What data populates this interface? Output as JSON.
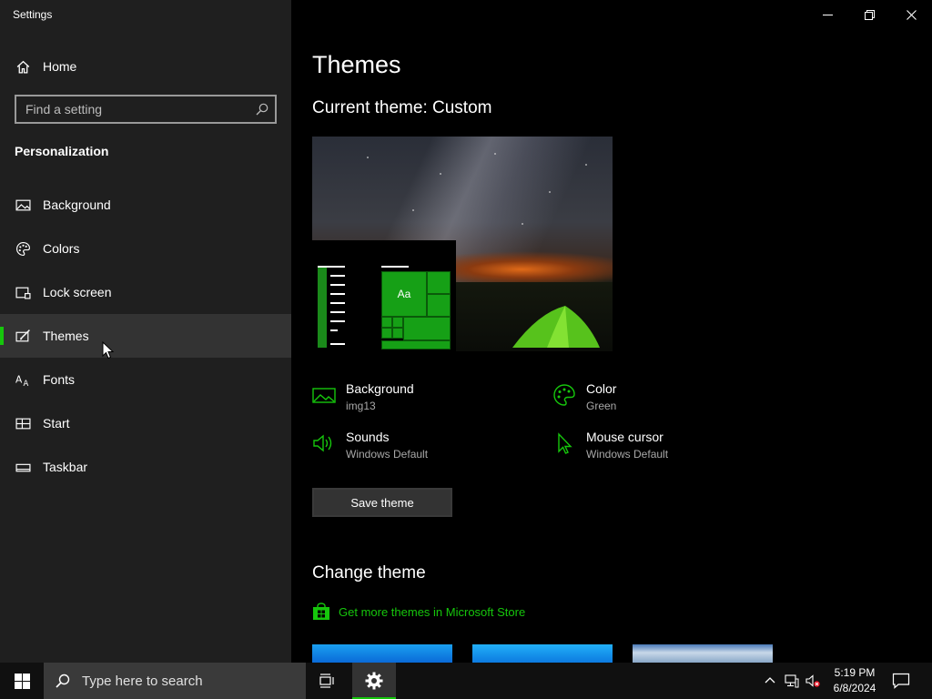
{
  "window": {
    "app_title": "Settings",
    "caption": [
      "minimize-icon",
      "restore-icon",
      "close-icon"
    ]
  },
  "sidebar": {
    "home_label": "Home",
    "search_placeholder": "Find a setting",
    "section_title": "Personalization",
    "items": [
      {
        "label": "Background",
        "icon": "picture-icon",
        "selected": false
      },
      {
        "label": "Colors",
        "icon": "palette-icon",
        "selected": false
      },
      {
        "label": "Lock screen",
        "icon": "lock-screen-icon",
        "selected": false
      },
      {
        "label": "Themes",
        "icon": "themes-brush-icon",
        "selected": true
      },
      {
        "label": "Fonts",
        "icon": "fonts-icon",
        "selected": false
      },
      {
        "label": "Start",
        "icon": "start-icon",
        "selected": false
      },
      {
        "label": "Taskbar",
        "icon": "taskbar-icon",
        "selected": false
      }
    ]
  },
  "main": {
    "page_title": "Themes",
    "current_theme": "Current theme: Custom",
    "preview_tile_text": "Aa",
    "properties": {
      "background": {
        "title": "Background",
        "value": "img13"
      },
      "color": {
        "title": "Color",
        "value": "Green"
      },
      "sounds": {
        "title": "Sounds",
        "value": "Windows Default"
      },
      "mouse_cursor": {
        "title": "Mouse cursor",
        "value": "Windows Default"
      }
    },
    "save_button": "Save theme",
    "change_theme_title": "Change theme",
    "store_link": "Get more themes in Microsoft Store"
  },
  "taskbar": {
    "search_placeholder": "Type here to search",
    "time": "5:19 PM",
    "date": "6/8/2024"
  },
  "colors": {
    "accent": "#16c60c",
    "sidebar_bg": "#1f1f1f",
    "main_bg": "#000000",
    "taskbar_bg": "#101010"
  }
}
